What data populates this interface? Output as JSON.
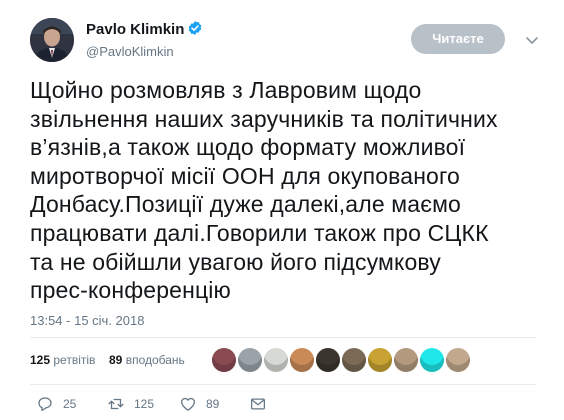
{
  "author": {
    "display_name": "Pavlo Klimkin",
    "handle": "@PavloKlimkin",
    "verified": true
  },
  "follow_button": {
    "label": "Читаєте"
  },
  "tweet": {
    "lines": [
      "Щойно розмовляв з Лавровим щодо",
      "звільнення наших заручників та політичних",
      "в’язнів,а також щодо формату можливої",
      "миротворчої місії ООН для окупованого",
      "Донбасу.Позиції дуже далекі,але маємо",
      "працювати далі.Говорили також про СЦКК",
      "та не обійшли увагою його підсумкову",
      "прес-конференцію"
    ],
    "timestamp": "13:54 - 15 січ. 2018"
  },
  "stats": {
    "retweets_count": "125",
    "retweets_label": "ретвітів",
    "likes_count": "89",
    "likes_label": "вподобань"
  },
  "liker_avatars": [
    {
      "color": "#8a4a52"
    },
    {
      "color": "#9aa3aa"
    },
    {
      "color": "#d7d9d4"
    },
    {
      "color": "#c98a58"
    },
    {
      "color": "#3a352e"
    },
    {
      "color": "#7b6a55"
    },
    {
      "color": "#c8a233"
    },
    {
      "color": "#b39a7e"
    },
    {
      "color": "#1ee8ea"
    },
    {
      "color": "#c2a88c"
    }
  ],
  "actions": {
    "reply_count": "25",
    "retweet_count": "125",
    "like_count": "89"
  },
  "colors": {
    "text": "#14171a",
    "secondary": "#657786",
    "verified": "#1da1f2",
    "follow_button_bg": "#b8c0c8"
  }
}
